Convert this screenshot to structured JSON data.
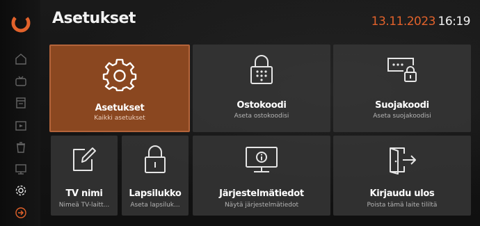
{
  "header": {
    "title": "Asetukset",
    "date": "13.11.2023",
    "time": "16:19"
  },
  "sidebar": {
    "items": [
      {
        "icon": "home-icon"
      },
      {
        "icon": "tv-icon"
      },
      {
        "icon": "guide-icon"
      },
      {
        "icon": "recordings-icon"
      },
      {
        "icon": "trash-icon"
      },
      {
        "icon": "screen-icon"
      },
      {
        "icon": "settings-icon",
        "active": true
      },
      {
        "icon": "logout-icon"
      }
    ]
  },
  "tiles": {
    "settings": {
      "title": "Asetukset",
      "subtitle": "Kaikki asetukset"
    },
    "purchase_code": {
      "title": "Ostokoodi",
      "subtitle": "Aseta ostokoodisi"
    },
    "protection_code": {
      "title": "Suojakoodi",
      "subtitle": "Aseta suojakoodisi"
    },
    "tv_name": {
      "title": "TV nimi",
      "subtitle": "Nimeä TV-laitt..."
    },
    "parental_lock": {
      "title": "Lapsilukko",
      "subtitle": "Aseta lapsiluk..."
    },
    "system_info": {
      "title": "Järjestelmätiedot",
      "subtitle": "Näytä järjestelmätiedot"
    },
    "logout": {
      "title": "Kirjaudu ulos",
      "subtitle": "Poista tämä laite tililtä"
    }
  },
  "colors": {
    "accent": "#e2622b",
    "active_tile": "#8a4720",
    "tile": "#373737"
  }
}
